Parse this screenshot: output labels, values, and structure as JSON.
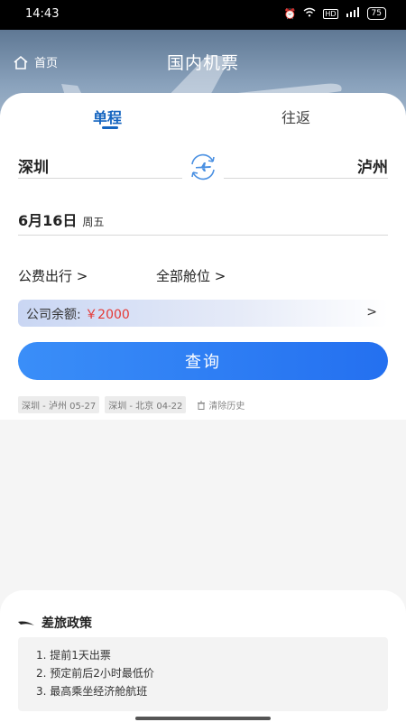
{
  "status": {
    "time": "14:43",
    "hd": "HD",
    "signal": "4G",
    "battery": "75"
  },
  "header": {
    "home_label": "首页",
    "title": "国内机票"
  },
  "tabs": [
    {
      "label": "单程",
      "active": true
    },
    {
      "label": "往返",
      "active": false
    }
  ],
  "route": {
    "from": "深圳",
    "to": "泸州"
  },
  "date": {
    "main": "6月16日",
    "weekday": "周五"
  },
  "options": {
    "purpose": "公费出行 >",
    "cabin": "全部舱位 >"
  },
  "balance": {
    "label": "公司余额: ",
    "value": "￥2000",
    "arrow": ">"
  },
  "search_label": "查询",
  "history": {
    "items": [
      "深圳 - 泸州 05-27",
      "深圳 - 北京 04-22"
    ],
    "clear_label": "清除历史"
  },
  "policy": {
    "title": "差旅政策",
    "rules": [
      "1. 提前1天出票",
      "2. 预定前后2小时最低价",
      "3. 最高乘坐经济舱航班"
    ]
  },
  "colors": {
    "accent": "#1565c0",
    "button": "#2c7cf4",
    "balance_value": "#e53935"
  }
}
